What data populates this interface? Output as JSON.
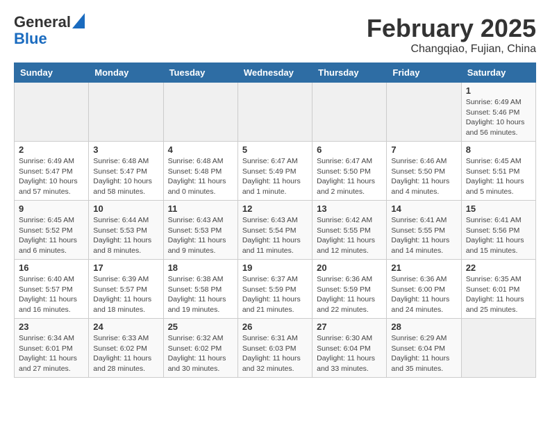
{
  "logo": {
    "line1": "General",
    "line2": "Blue"
  },
  "header": {
    "month_year": "February 2025",
    "location": "Changqiao, Fujian, China"
  },
  "days_of_week": [
    "Sunday",
    "Monday",
    "Tuesday",
    "Wednesday",
    "Thursday",
    "Friday",
    "Saturday"
  ],
  "weeks": [
    [
      {
        "day": "",
        "info": ""
      },
      {
        "day": "",
        "info": ""
      },
      {
        "day": "",
        "info": ""
      },
      {
        "day": "",
        "info": ""
      },
      {
        "day": "",
        "info": ""
      },
      {
        "day": "",
        "info": ""
      },
      {
        "day": "1",
        "info": "Sunrise: 6:49 AM\nSunset: 5:46 PM\nDaylight: 10 hours\nand 56 minutes."
      }
    ],
    [
      {
        "day": "2",
        "info": "Sunrise: 6:49 AM\nSunset: 5:47 PM\nDaylight: 10 hours\nand 57 minutes."
      },
      {
        "day": "3",
        "info": "Sunrise: 6:48 AM\nSunset: 5:47 PM\nDaylight: 10 hours\nand 58 minutes."
      },
      {
        "day": "4",
        "info": "Sunrise: 6:48 AM\nSunset: 5:48 PM\nDaylight: 11 hours\nand 0 minutes."
      },
      {
        "day": "5",
        "info": "Sunrise: 6:47 AM\nSunset: 5:49 PM\nDaylight: 11 hours\nand 1 minute."
      },
      {
        "day": "6",
        "info": "Sunrise: 6:47 AM\nSunset: 5:50 PM\nDaylight: 11 hours\nand 2 minutes."
      },
      {
        "day": "7",
        "info": "Sunrise: 6:46 AM\nSunset: 5:50 PM\nDaylight: 11 hours\nand 4 minutes."
      },
      {
        "day": "8",
        "info": "Sunrise: 6:45 AM\nSunset: 5:51 PM\nDaylight: 11 hours\nand 5 minutes."
      }
    ],
    [
      {
        "day": "9",
        "info": "Sunrise: 6:45 AM\nSunset: 5:52 PM\nDaylight: 11 hours\nand 6 minutes."
      },
      {
        "day": "10",
        "info": "Sunrise: 6:44 AM\nSunset: 5:53 PM\nDaylight: 11 hours\nand 8 minutes."
      },
      {
        "day": "11",
        "info": "Sunrise: 6:43 AM\nSunset: 5:53 PM\nDaylight: 11 hours\nand 9 minutes."
      },
      {
        "day": "12",
        "info": "Sunrise: 6:43 AM\nSunset: 5:54 PM\nDaylight: 11 hours\nand 11 minutes."
      },
      {
        "day": "13",
        "info": "Sunrise: 6:42 AM\nSunset: 5:55 PM\nDaylight: 11 hours\nand 12 minutes."
      },
      {
        "day": "14",
        "info": "Sunrise: 6:41 AM\nSunset: 5:55 PM\nDaylight: 11 hours\nand 14 minutes."
      },
      {
        "day": "15",
        "info": "Sunrise: 6:41 AM\nSunset: 5:56 PM\nDaylight: 11 hours\nand 15 minutes."
      }
    ],
    [
      {
        "day": "16",
        "info": "Sunrise: 6:40 AM\nSunset: 5:57 PM\nDaylight: 11 hours\nand 16 minutes."
      },
      {
        "day": "17",
        "info": "Sunrise: 6:39 AM\nSunset: 5:57 PM\nDaylight: 11 hours\nand 18 minutes."
      },
      {
        "day": "18",
        "info": "Sunrise: 6:38 AM\nSunset: 5:58 PM\nDaylight: 11 hours\nand 19 minutes."
      },
      {
        "day": "19",
        "info": "Sunrise: 6:37 AM\nSunset: 5:59 PM\nDaylight: 11 hours\nand 21 minutes."
      },
      {
        "day": "20",
        "info": "Sunrise: 6:36 AM\nSunset: 5:59 PM\nDaylight: 11 hours\nand 22 minutes."
      },
      {
        "day": "21",
        "info": "Sunrise: 6:36 AM\nSunset: 6:00 PM\nDaylight: 11 hours\nand 24 minutes."
      },
      {
        "day": "22",
        "info": "Sunrise: 6:35 AM\nSunset: 6:01 PM\nDaylight: 11 hours\nand 25 minutes."
      }
    ],
    [
      {
        "day": "23",
        "info": "Sunrise: 6:34 AM\nSunset: 6:01 PM\nDaylight: 11 hours\nand 27 minutes."
      },
      {
        "day": "24",
        "info": "Sunrise: 6:33 AM\nSunset: 6:02 PM\nDaylight: 11 hours\nand 28 minutes."
      },
      {
        "day": "25",
        "info": "Sunrise: 6:32 AM\nSunset: 6:02 PM\nDaylight: 11 hours\nand 30 minutes."
      },
      {
        "day": "26",
        "info": "Sunrise: 6:31 AM\nSunset: 6:03 PM\nDaylight: 11 hours\nand 32 minutes."
      },
      {
        "day": "27",
        "info": "Sunrise: 6:30 AM\nSunset: 6:04 PM\nDaylight: 11 hours\nand 33 minutes."
      },
      {
        "day": "28",
        "info": "Sunrise: 6:29 AM\nSunset: 6:04 PM\nDaylight: 11 hours\nand 35 minutes."
      },
      {
        "day": "",
        "info": ""
      }
    ]
  ]
}
